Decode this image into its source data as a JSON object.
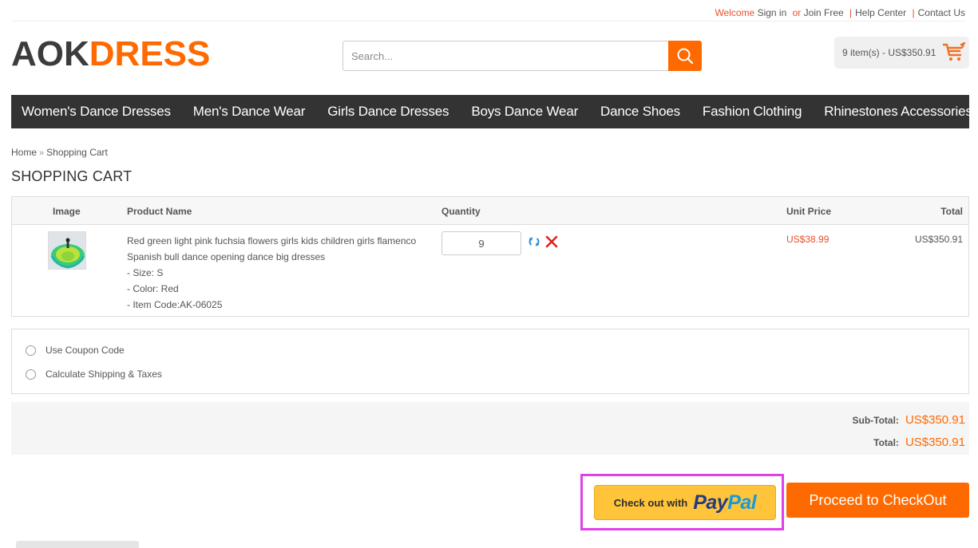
{
  "topbar": {
    "welcome": "Welcome",
    "sign_in": "Sign in",
    "or": "or",
    "join_free": "Join Free",
    "help_center": "Help Center",
    "contact_us": "Contact Us",
    "separator": "|"
  },
  "header": {
    "logo_part1": "AOK",
    "logo_part2": "DRESS",
    "search": {
      "placeholder": "Search...",
      "value": ""
    },
    "cart_summary": "9 item(s) - US$350.91"
  },
  "nav": {
    "items": [
      {
        "label": "Women's Dance Dresses"
      },
      {
        "label": "Men's Dance Wear"
      },
      {
        "label": "Girls Dance Dresses"
      },
      {
        "label": "Boys Dance Wear"
      },
      {
        "label": "Dance Shoes"
      },
      {
        "label": "Fashion Clothing"
      },
      {
        "label": "Rhinestones Accessories"
      }
    ]
  },
  "breadcrumb": {
    "home": "Home",
    "separator": "»",
    "current": "Shopping Cart"
  },
  "page_title": "SHOPPING CART",
  "cart": {
    "columns": {
      "image": "Image",
      "product_name": "Product Name",
      "quantity": "Quantity",
      "unit_price": "Unit Price",
      "total": "Total"
    },
    "items": [
      {
        "name_line1": "Red green light pink fuchsia flowers girls kids children girls flamenco",
        "name_line2": "Spanish bull dance opening dance big dresses",
        "size": "- Size: S",
        "color": "- Color: Red",
        "item_code": "- Item Code:AK-06025",
        "quantity": "9",
        "unit_price": "US$38.99",
        "total": "US$350.91"
      }
    ]
  },
  "options": {
    "coupon": "Use Coupon Code",
    "shipping": "Calculate Shipping & Taxes"
  },
  "totals": {
    "subtotal_label": "Sub-Total:",
    "subtotal_value": "US$350.91",
    "total_label": "Total:",
    "total_value": "US$350.91"
  },
  "checkout": {
    "paypal_prefix": "Check out with",
    "paypal_pay": "Pay",
    "paypal_pal": "Pal",
    "proceed": "Proceed to CheckOut"
  },
  "colors": {
    "accent": "#ff6a00",
    "nav_bg": "#333333",
    "price_red": "#e8502a",
    "paypal_yellow": "#ffc439",
    "highlight_frame": "#e040e8"
  }
}
